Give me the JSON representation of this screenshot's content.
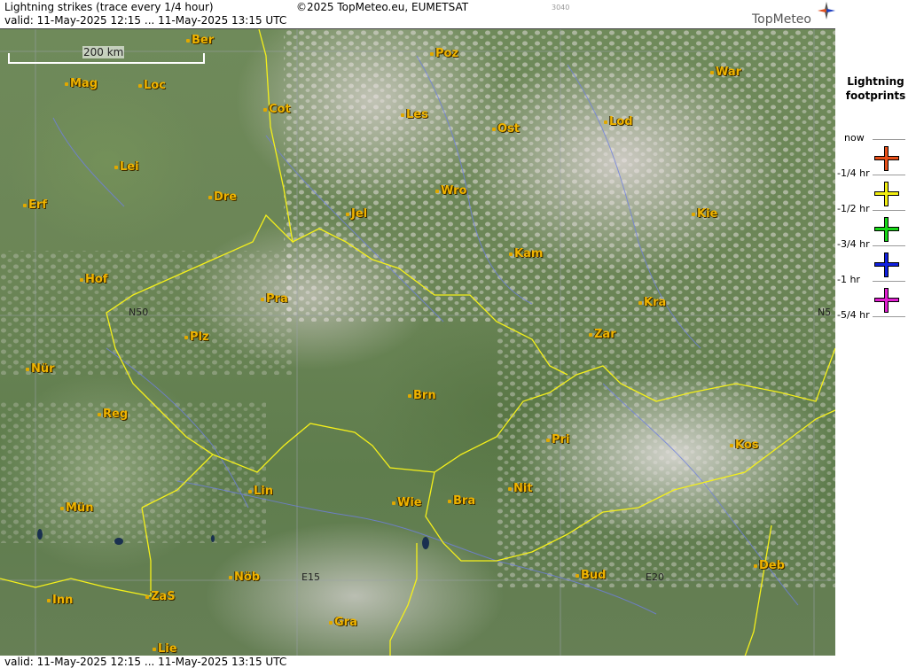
{
  "header": {
    "title": "Lightning strikes (trace every 1/4 hour)",
    "copyright": "©2025 TopMeteo.eu, EUMETSAT",
    "code": "3040",
    "valid": "valid:  11-May-2025 12:15 ... 11-May-2025 13:15 UTC",
    "logo": "TopMeteo"
  },
  "map": {
    "scale_label": "200 km",
    "grid_labels": {
      "n50_left": "N50",
      "n50_right": "N5",
      "e15": "E15",
      "e20": "E20"
    },
    "cities": [
      {
        "id": "ber",
        "name": "Ber"
      },
      {
        "id": "poz",
        "name": "Poz"
      },
      {
        "id": "war",
        "name": "War"
      },
      {
        "id": "mag",
        "name": "Mag"
      },
      {
        "id": "loc",
        "name": "Loc"
      },
      {
        "id": "cot",
        "name": "Cot"
      },
      {
        "id": "les",
        "name": "Les"
      },
      {
        "id": "ost",
        "name": "Ost"
      },
      {
        "id": "lod",
        "name": "Lod"
      },
      {
        "id": "lei",
        "name": "Lei"
      },
      {
        "id": "erf",
        "name": "Erf"
      },
      {
        "id": "dre",
        "name": "Dre"
      },
      {
        "id": "wro",
        "name": "Wro"
      },
      {
        "id": "jel",
        "name": "Jel"
      },
      {
        "id": "kie",
        "name": "Kie"
      },
      {
        "id": "kam",
        "name": "Kam"
      },
      {
        "id": "hof",
        "name": "Hof"
      },
      {
        "id": "pra",
        "name": "Pra"
      },
      {
        "id": "kra",
        "name": "Kra"
      },
      {
        "id": "zar",
        "name": "Zar"
      },
      {
        "id": "plz",
        "name": "Plz"
      },
      {
        "id": "nur",
        "name": "Nür"
      },
      {
        "id": "brn",
        "name": "Brn"
      },
      {
        "id": "reg",
        "name": "Reg"
      },
      {
        "id": "pri",
        "name": "Pri"
      },
      {
        "id": "kos",
        "name": "Kos"
      },
      {
        "id": "lin",
        "name": "Lin"
      },
      {
        "id": "nit",
        "name": "Nit"
      },
      {
        "id": "mun",
        "name": "Mün"
      },
      {
        "id": "wie",
        "name": "Wie"
      },
      {
        "id": "bra",
        "name": "Bra"
      },
      {
        "id": "nob",
        "name": "Nöb"
      },
      {
        "id": "bud",
        "name": "Bud"
      },
      {
        "id": "deb",
        "name": "Deb"
      },
      {
        "id": "inn",
        "name": "Inn"
      },
      {
        "id": "zas",
        "name": "ZaS"
      },
      {
        "id": "gra",
        "name": "Gra"
      },
      {
        "id": "lie",
        "name": "Lie"
      }
    ]
  },
  "legend": {
    "title_line1": "Lightning",
    "title_line2": "footprints",
    "rows": [
      {
        "label": "now"
      },
      {
        "label": "-1/4 hr",
        "color": "#e8501a"
      },
      {
        "label": "-1/2 hr",
        "color": "#f2ee10"
      },
      {
        "label": "-3/4 hr",
        "color": "#18d818"
      },
      {
        "label": "-1 hr",
        "color": "#1020e0"
      },
      {
        "label": "-5/4 hr",
        "color": "#e020d0"
      }
    ]
  }
}
